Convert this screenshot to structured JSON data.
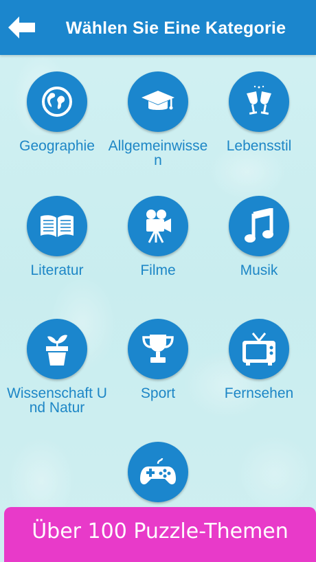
{
  "header": {
    "title": "Wählen Sie Eine Kategorie",
    "back_icon": "arrow-left-icon"
  },
  "categories": [
    {
      "label": "Geographie",
      "icon": "globe-icon"
    },
    {
      "label": "Allgemeinwissen",
      "icon": "graduation-cap-icon"
    },
    {
      "label": "Lebensstil",
      "icon": "wine-glasses-icon"
    },
    {
      "label": "Literatur",
      "icon": "open-book-icon"
    },
    {
      "label": "Filme",
      "icon": "movie-camera-icon"
    },
    {
      "label": "Musik",
      "icon": "music-note-icon"
    },
    {
      "label": "Wissenschaft Und Natur",
      "icon": "plant-pot-icon"
    },
    {
      "label": "Sport",
      "icon": "trophy-icon"
    },
    {
      "label": "Fernsehen",
      "icon": "tv-icon"
    },
    {
      "label": "",
      "icon": "gamepad-icon"
    }
  ],
  "banner": {
    "text": "Über 100 Puzzle-Themen"
  },
  "colors": {
    "primary": "#1b86cd",
    "label": "#1d86c6",
    "banner": "#e83ac9",
    "background": "#cdeef0"
  }
}
